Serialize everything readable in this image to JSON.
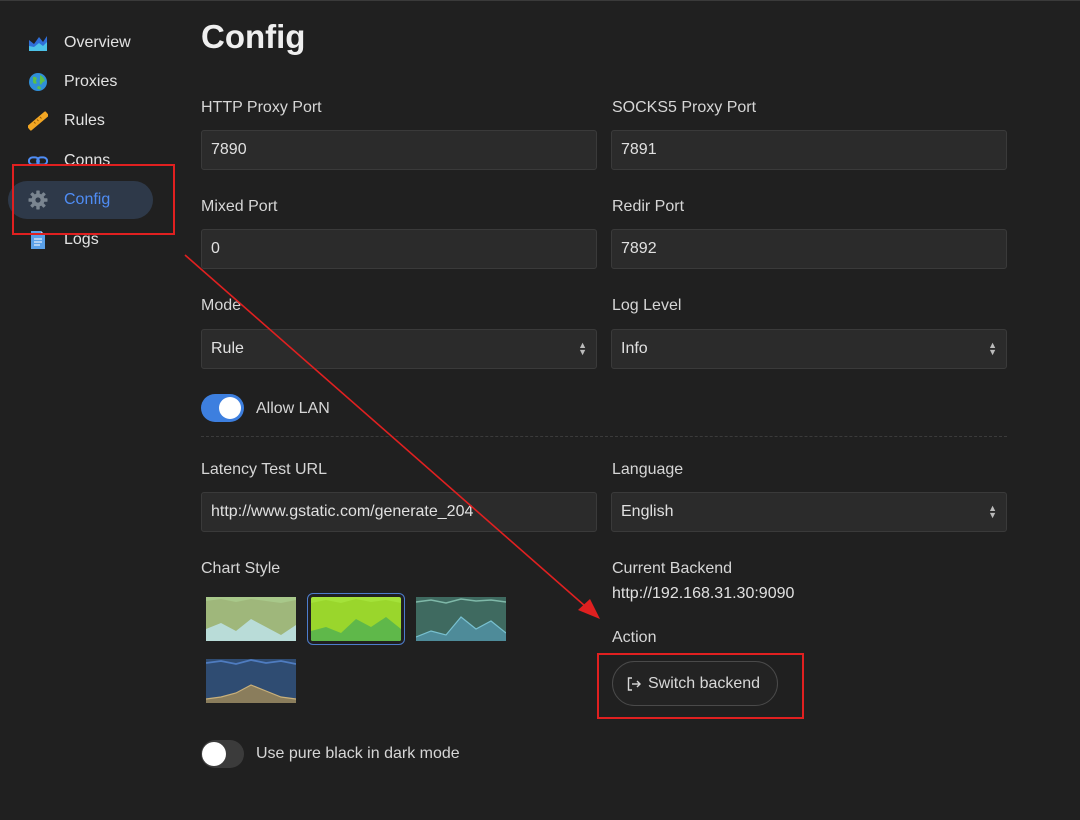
{
  "sidebar": {
    "items": [
      {
        "label": "Overview",
        "icon": "chart-icon"
      },
      {
        "label": "Proxies",
        "icon": "globe-icon"
      },
      {
        "label": "Rules",
        "icon": "ruler-icon"
      },
      {
        "label": "Conns",
        "icon": "link-icon"
      },
      {
        "label": "Config",
        "icon": "gear-icon",
        "active": true
      },
      {
        "label": "Logs",
        "icon": "document-icon"
      }
    ]
  },
  "page": {
    "title": "Config"
  },
  "config": {
    "http_port": {
      "label": "HTTP Proxy Port",
      "value": "7890"
    },
    "socks_port": {
      "label": "SOCKS5 Proxy Port",
      "value": "7891"
    },
    "mixed_port": {
      "label": "Mixed Port",
      "value": "0"
    },
    "redir_port": {
      "label": "Redir Port",
      "value": "7892"
    },
    "mode": {
      "label": "Mode",
      "value": "Rule"
    },
    "log_level": {
      "label": "Log Level",
      "value": "Info"
    },
    "allow_lan": {
      "label": "Allow LAN",
      "on": true
    },
    "latency_url": {
      "label": "Latency Test URL",
      "value": "http://www.gstatic.com/generate_204"
    },
    "language": {
      "label": "Language",
      "value": "English"
    },
    "chart_style": {
      "label": "Chart Style",
      "selected_index": 1
    },
    "current_backend": {
      "label": "Current Backend",
      "value": "http://192.168.31.30:9090"
    },
    "action": {
      "label": "Action",
      "button": "Switch backend"
    },
    "pure_black": {
      "label": "Use pure black in dark mode",
      "on": false
    }
  },
  "colors": {
    "accent": "#3d7fdf",
    "active_text": "#4f8df5",
    "annotation": "#e02020"
  }
}
